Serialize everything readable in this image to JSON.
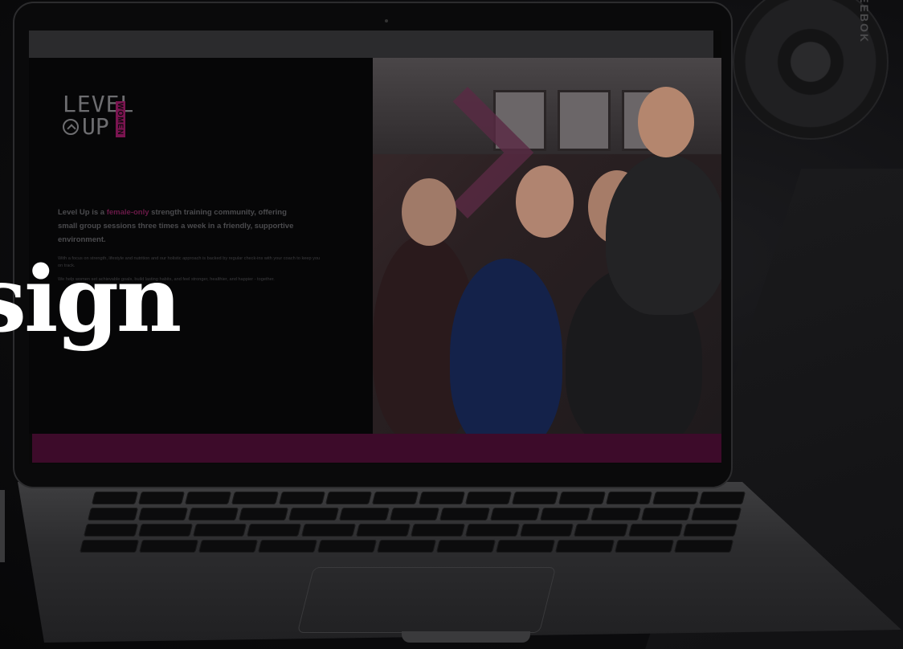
{
  "overlay": {
    "heading_fragment": "sign"
  },
  "website": {
    "logo": {
      "level": "LEVEL",
      "up": "UP",
      "women": "WOMEN"
    },
    "intro": {
      "before_accent": "Level Up is a ",
      "accent": "female-only",
      "after_accent": " strength training community, offering small group sessions three times a week in a friendly, supportive environment."
    },
    "paragraphs": [
      "With a focus on strength, lifestyle and nutrition and our holistic approach is backed by regular check-ins with your coach to keep you on track.",
      "We help women set achievable goals, build lasting habits, and feel stronger, healthier, and happier - together."
    ]
  },
  "colors": {
    "accent": "#7a1450",
    "band": "#3d0b2a",
    "screen_bg": "#060607"
  },
  "icons": {
    "logo_mark": "chevron-up-circle-icon"
  },
  "background": {
    "plate_text": "REEBOK"
  }
}
